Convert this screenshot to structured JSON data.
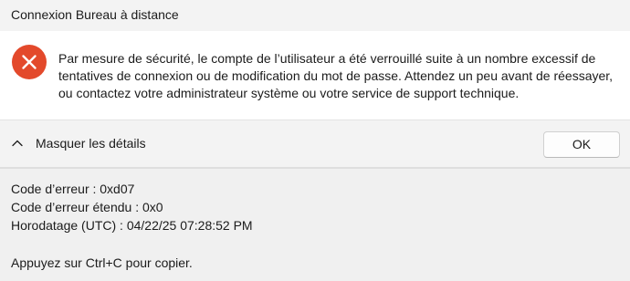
{
  "window": {
    "title": "Connexion Bureau à distance"
  },
  "message": {
    "icon": "error-icon",
    "text": "Par mesure de sécurité, le compte de l’utilisateur a été verrouillé suite à un nombre excessif de tentatives de connexion ou de modification du mot de passe. Attendez un peu avant de réessayer, ou contactez votre administrateur système ou votre service de support technique."
  },
  "buttons": {
    "details_toggle": "Masquer les détails",
    "ok": "OK"
  },
  "details": {
    "error_code": "Code d’erreur : 0xd07",
    "extended_error_code": "Code d’erreur étendu : 0x0",
    "timestamp": "Horodatage (UTC) : 04/22/25 07:28:52 PM",
    "copy_hint": "Appuyez sur Ctrl+C pour copier."
  },
  "colors": {
    "error_red": "#e3492b",
    "content_background": "#ffffff",
    "dialog_background": "#f0f0f0"
  }
}
